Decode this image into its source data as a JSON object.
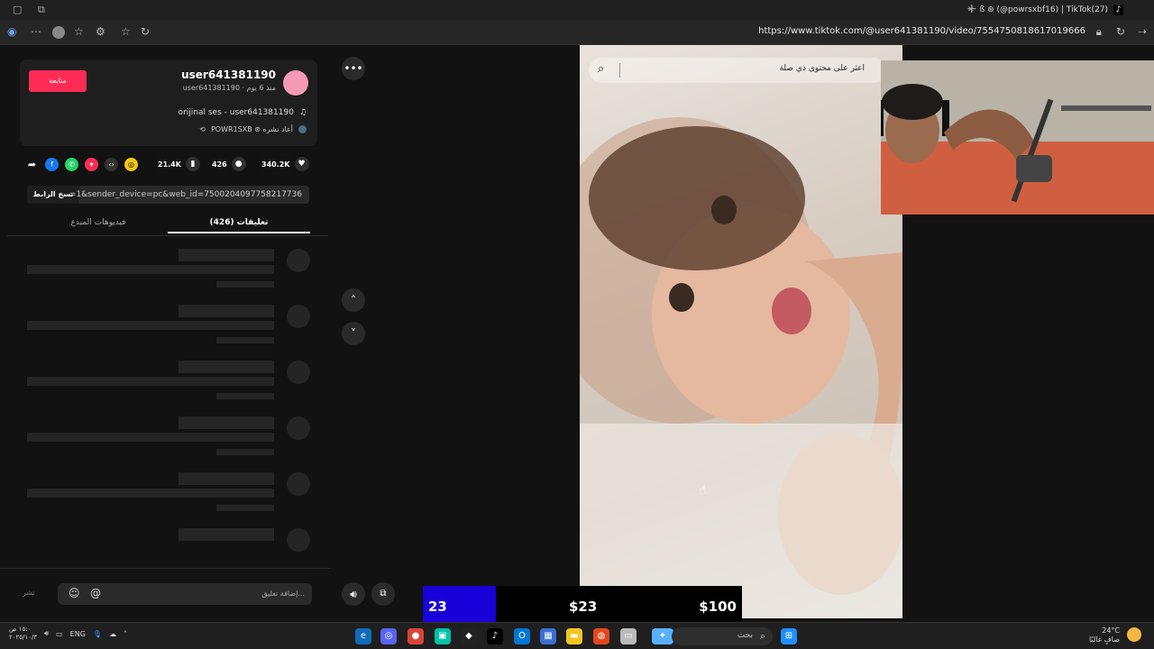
{
  "browser": {
    "tab_title": "ß ⊛ (@powrsxbf16) | TikTok(27)",
    "url": "https://www.tiktok.com/@user641381190/video/7554750818617019666"
  },
  "creator": {
    "follow_label": "متابعة",
    "username": "user641381190",
    "subline": "user641381190 · منذ 6 يوم",
    "music": "orijinal ses - user641381190",
    "reposted": "POWR1SXB ⊛ أعاد نشره"
  },
  "stats": {
    "likes": "340.2K",
    "comments": "426",
    "saves": "21.4K"
  },
  "link": {
    "copy_label": "نسخ الرابط",
    "text": "...=1&sender_device=pc&web_id=7500204097758217736"
  },
  "tabs": {
    "comments": "تعليقات (426)",
    "creator_videos": "فيديوهات المبدع"
  },
  "comment_box": {
    "placeholder": "إضافة تعليق...",
    "post_label": "نشر"
  },
  "video": {
    "search_placeholder": "اعثر على محتوى ذي صلة"
  },
  "donation": {
    "count": "23",
    "current": "$23",
    "goal": "$100"
  },
  "taskbar": {
    "time": "١٥:٠ ص",
    "date": "٢٠٢٥/١٠/٣",
    "language": "ENG",
    "search_label": "بحث",
    "temperature": "24°C",
    "weather_desc": "صافٍ غالبًا"
  },
  "colors": {
    "follow": "#fe2c55",
    "donation_accent": "#1800d8"
  }
}
